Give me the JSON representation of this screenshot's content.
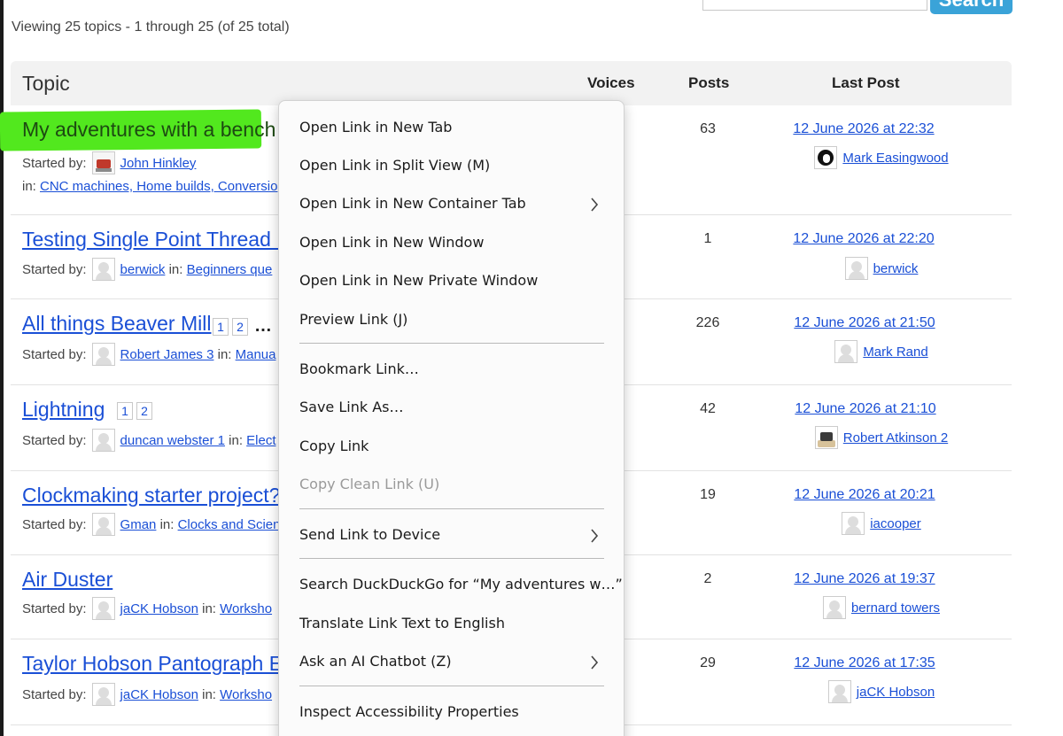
{
  "header": {
    "search_button": "Search",
    "viewing_text": "Viewing 25 topics - 1 through 25 (of 25 total)"
  },
  "table": {
    "headers": {
      "topic": "Topic",
      "voices": "Voices",
      "posts": "Posts",
      "last_post": "Last Post"
    },
    "rows": [
      {
        "title": "My adventures with a bench t",
        "started_by_label": "Started by:",
        "author": "John Hinkley",
        "in_label": "in:",
        "forum": "CNC machines, Home builds, Conversio",
        "posts": "63",
        "last_date": "12 June 2026 at 22:32",
        "last_user": "Mark Easingwood"
      },
      {
        "title": "Testing Single Point Thread F",
        "started_by_label": "Started by:",
        "author": "berwick",
        "in_label": "in:",
        "forum": "Beginners que",
        "posts": "1",
        "last_date": "12 June 2026 at 22:20",
        "last_user": "berwick"
      },
      {
        "title": "All things Beaver Mill",
        "pages": [
          "1",
          "2"
        ],
        "ellipsis": "…",
        "started_by_label": "Started by:",
        "author": "Robert James 3",
        "in_label": "in:",
        "forum": "Manua",
        "posts": "226",
        "last_date": "12 June 2026 at 21:50",
        "last_user": "Mark Rand"
      },
      {
        "title": "Lightning",
        "pages": [
          "1",
          "2"
        ],
        "started_by_label": "Started by:",
        "author": "duncan webster 1",
        "in_label": "in:",
        "forum": "Elect",
        "posts": "42",
        "last_date": "12 June 2026 at 21:10",
        "last_user": "Robert Atkinson 2"
      },
      {
        "title": "Clockmaking starter project?",
        "started_by_label": "Started by:",
        "author": "Gman",
        "in_label": "in:",
        "forum": "Clocks and Scien",
        "posts": "19",
        "last_date": "12 June 2026 at 20:21",
        "last_user": "iacooper"
      },
      {
        "title": "Air Duster",
        "started_by_label": "Started by:",
        "author": "jaCK Hobson",
        "in_label": "in:",
        "forum": "Worksho",
        "posts": "2",
        "last_date": "12 June 2026 at 19:37",
        "last_user": "bernard towers"
      },
      {
        "title": "Taylor Hobson Pantograph Er",
        "started_by_label": "Started by:",
        "author": "jaCK Hobson",
        "in_label": "in:",
        "forum": "Worksho",
        "posts": "29",
        "last_date": "12 June 2026 at 17:35",
        "last_user": "jaCK Hobson"
      }
    ]
  },
  "context_menu": {
    "items": [
      {
        "label": "Open Link in New Tab"
      },
      {
        "label": "Open Link in Split View (M)"
      },
      {
        "label": "Open Link in New Container Tab",
        "submenu": true
      },
      {
        "label": "Open Link in New Window"
      },
      {
        "label": "Open Link in New Private Window"
      },
      {
        "label": "Preview Link (J)"
      },
      {
        "label": "Bookmark Link…"
      },
      {
        "label": "Save Link As…"
      },
      {
        "label": "Copy Link"
      },
      {
        "label": "Copy Clean Link (U)",
        "disabled": true
      },
      {
        "label": "Send Link to Device",
        "submenu": true
      },
      {
        "label": "Search DuckDuckGo for “My adventures w…”"
      },
      {
        "label": "Translate Link Text to English"
      },
      {
        "label": "Ask an AI Chatbot (Z)",
        "submenu": true
      },
      {
        "label": "Inspect Accessibility Properties"
      }
    ]
  },
  "colors": {
    "link": "#1a4fd6",
    "highlight": "#52e81e",
    "search_button": "#3aa3d8",
    "header_bg": "#f2f2f2"
  },
  "icons": {
    "submenu": "chevron-right-icon",
    "avatar": "user-avatar-icon"
  }
}
